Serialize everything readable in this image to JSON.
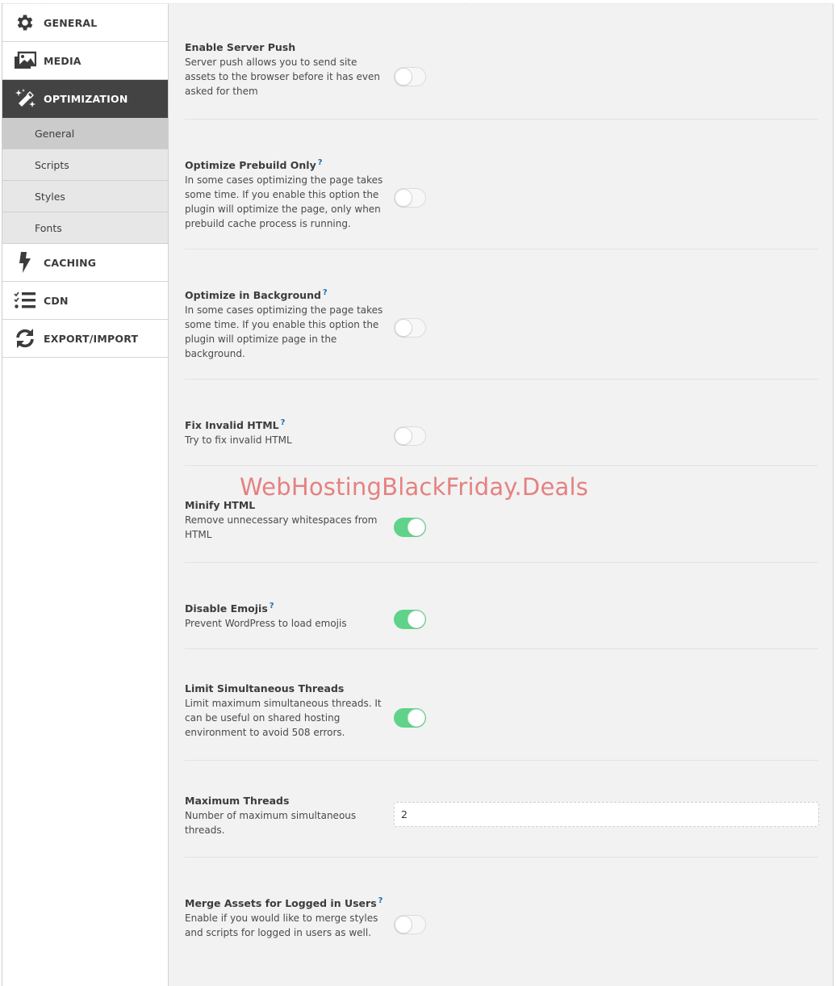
{
  "sidebar": {
    "items": [
      {
        "label": "GENERAL",
        "icon": "gear-icon",
        "active": false
      },
      {
        "label": "MEDIA",
        "icon": "images-icon",
        "active": false
      },
      {
        "label": "OPTIMIZATION",
        "icon": "magic-wand-icon",
        "active": true
      },
      {
        "label": "CACHING",
        "icon": "lightning-bolt-icon",
        "active": false
      },
      {
        "label": "CDN",
        "icon": "checklist-icon",
        "active": false
      },
      {
        "label": "EXPORT/IMPORT",
        "icon": "sync-icon",
        "active": false
      }
    ],
    "subitems": [
      {
        "label": "General",
        "active": true
      },
      {
        "label": "Scripts",
        "active": false
      },
      {
        "label": "Styles",
        "active": false
      },
      {
        "label": "Fonts",
        "active": false
      }
    ]
  },
  "settings": [
    {
      "title": "Enable Server Push",
      "help": "",
      "description": "Server push allows you to send site assets to the browser before it has even asked for them",
      "control": "toggle",
      "enabled": false
    },
    {
      "title": "Optimize Prebuild Only",
      "help": "?",
      "description": "In some cases optimizing the page takes some time. If you enable this option the plugin will optimize the page, only when prebuild cache process is running.",
      "control": "toggle",
      "enabled": false
    },
    {
      "title": "Optimize in Background",
      "help": "?",
      "description": "In some cases optimizing the page takes some time. If you enable this option the plugin will optimize page in the background.",
      "control": "toggle",
      "enabled": false
    },
    {
      "title": "Fix Invalid HTML",
      "help": "?",
      "description": "Try to fix invalid HTML",
      "control": "toggle",
      "enabled": false
    },
    {
      "title": "Minify HTML",
      "help": "",
      "description": "Remove unnecessary whitespaces from HTML",
      "control": "toggle",
      "enabled": true
    },
    {
      "title": "Disable Emojis",
      "help": "?",
      "description": "Prevent WordPress to load emojis",
      "control": "toggle",
      "enabled": true
    },
    {
      "title": "Limit Simultaneous Threads",
      "help": "",
      "description": "Limit maximum simultaneous threads. It can be useful on shared hosting environment to avoid 508 errors.",
      "control": "toggle",
      "enabled": true
    },
    {
      "title": "Maximum Threads",
      "help": "",
      "description": "Number of maximum simultaneous threads.",
      "control": "input",
      "value": "2"
    },
    {
      "title": "Merge Assets for Logged in Users",
      "help": "?",
      "description": "Enable if you would like to merge styles and scripts for logged in users as well.",
      "control": "toggle",
      "enabled": false
    }
  ],
  "watermark": "WebHostingBlackFriday.Deals",
  "colors": {
    "active_nav": "#434343",
    "toggle_on": "#5fd38a",
    "help_link": "#1a6fb0",
    "watermark": "#e57b7b"
  }
}
